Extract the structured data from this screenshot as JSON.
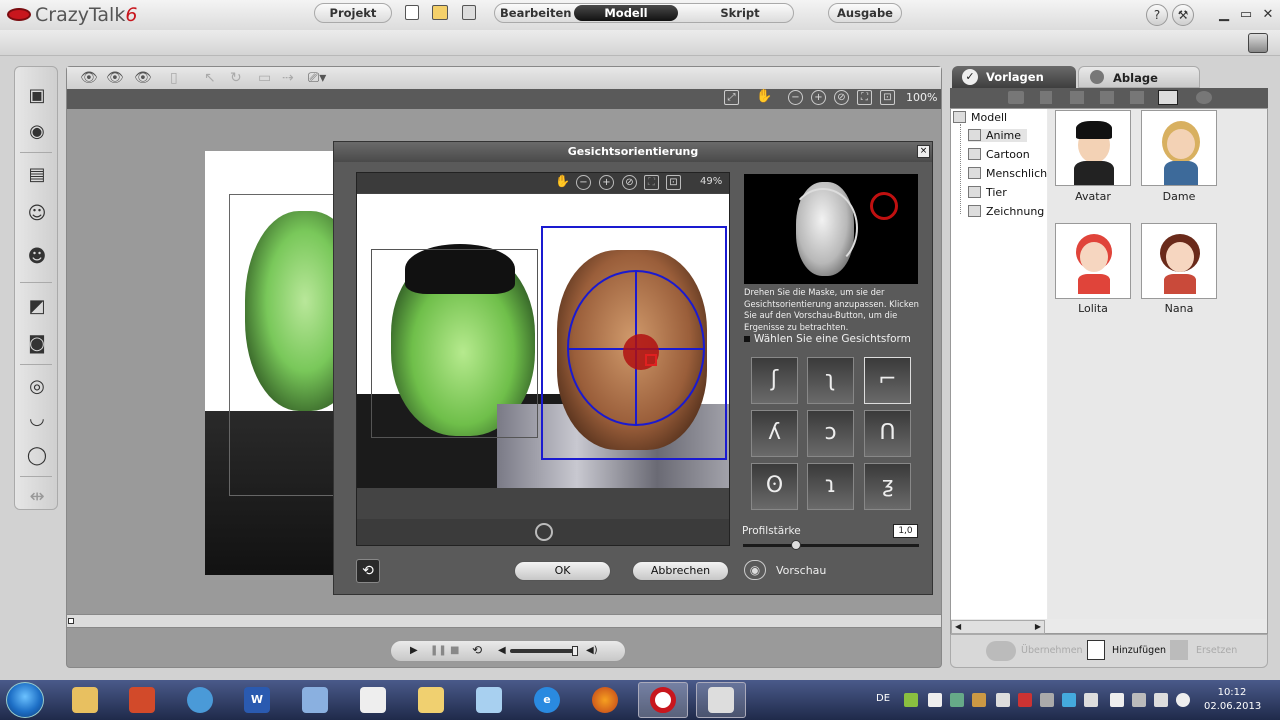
{
  "app": {
    "name_main": "CrazyTalk",
    "name_version": "6",
    "help_label": "?",
    "tools_label": "⚒",
    "minimize_label": "▁",
    "maximize_label": "▭",
    "close_label": "✕"
  },
  "menu": {
    "projekt": "Projekt",
    "bearbeiten": "Bearbeiten",
    "modell": "Modell",
    "skript": "Skript",
    "ausgabe": "Ausgabe"
  },
  "workspace": {
    "zoom": "100%"
  },
  "dialog": {
    "title": "Gesichtsorientierung",
    "close_label": "×",
    "viewport_zoom": "49%",
    "hint": "Drehen Sie die Maske, um sie der Gesichtsorientierung anzupassen. Klicken Sie auf den Vorschau-Button, um die Ergenisse zu betrachten.",
    "shape_label": "Wählen Sie eine Gesichtsform",
    "shapes": [
      "ʃ",
      "ʅ",
      "⌐",
      "ʎ",
      "ɔ",
      "ᑎ",
      "ʘ",
      "ɿ",
      "ƺ"
    ],
    "profile_label": "Profilstärke",
    "profile_value": "1,0",
    "profile_level": 0.3,
    "ok_label": "OK",
    "cancel_label": "Abbrechen",
    "preview_label": "Vorschau"
  },
  "right_panel": {
    "tab_vorlagen": "Vorlagen",
    "tab_ablage": "Ablage",
    "tree": {
      "root": "Modell",
      "items": [
        "Anime",
        "Cartoon",
        "Menschlich",
        "Tier",
        "Zeichnung"
      ]
    },
    "thumbnails": [
      "Avatar",
      "Dame",
      "Lolita",
      "Nana"
    ],
    "bottom": {
      "uebernehmen": "Übernehmen",
      "hinzufuegen": "Hinzufügen",
      "ersetzen": "Ersetzen"
    }
  },
  "taskbar": {
    "lang": "DE",
    "time": "10:12",
    "date": "02.06.2013",
    "apps": [
      "explorer",
      "installer",
      "mail",
      "word",
      "paint",
      "document",
      "folder",
      "notepad",
      "ie",
      "firefox",
      "crazytalk",
      "window"
    ]
  }
}
